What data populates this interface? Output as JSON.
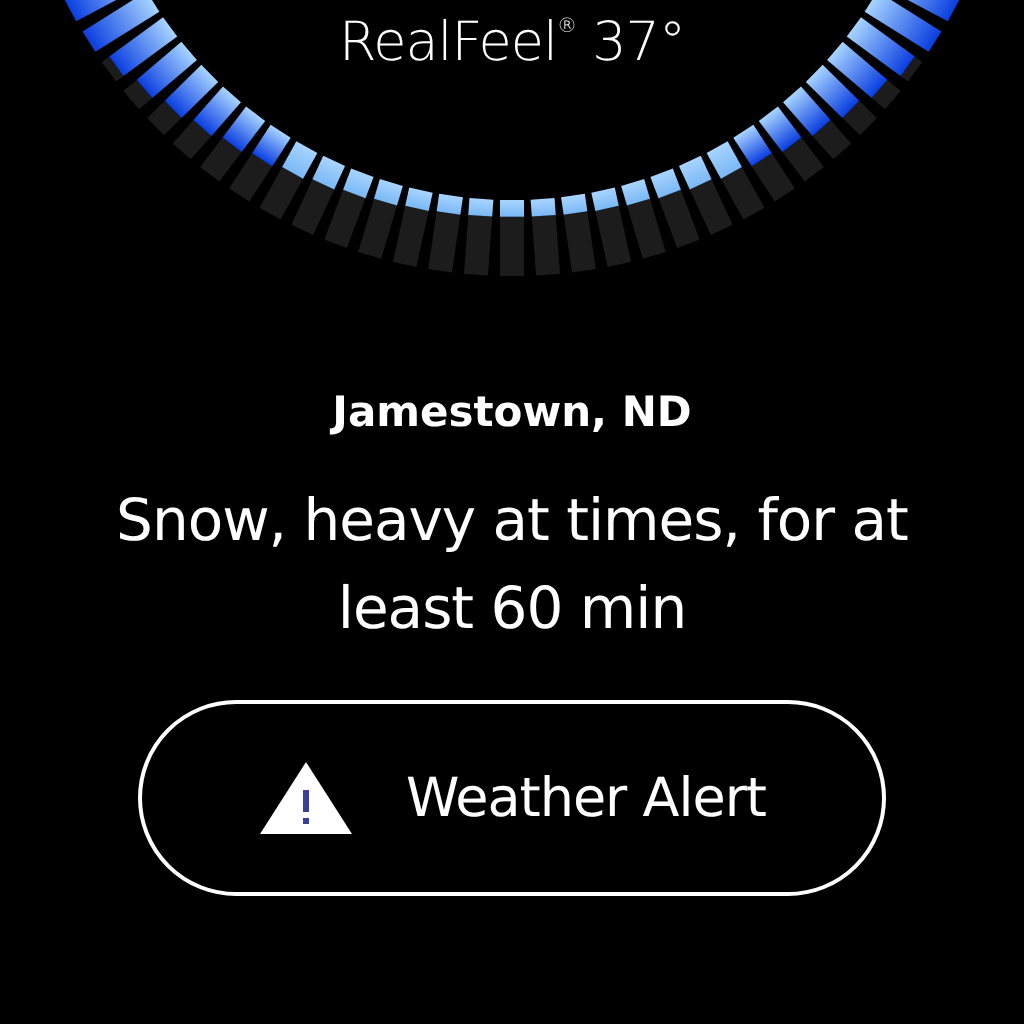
{
  "realfeel": "RealFeel$^{®}$ 37°",
  "location": "Jamestown, ND",
  "forecast": "Snow, heavy at times, for at least 60 min",
  "alert_button": {
    "label": "Weather Alert"
  }
}
